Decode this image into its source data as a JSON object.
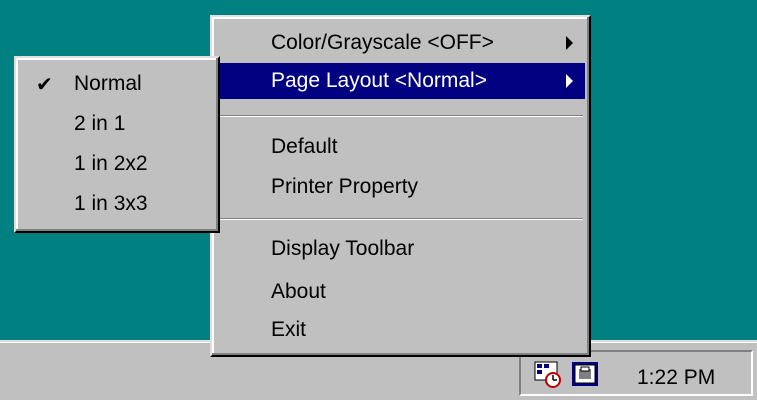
{
  "main_menu": {
    "items": [
      {
        "label": "Color/Grayscale <OFF>",
        "has_submenu": true,
        "highlighted": false
      },
      {
        "label": "Page Layout <Normal>",
        "has_submenu": true,
        "highlighted": true
      },
      {
        "label": "Default"
      },
      {
        "label": "Printer Property"
      },
      {
        "label": "Display Toolbar"
      },
      {
        "label": "About"
      },
      {
        "label": "Exit"
      }
    ]
  },
  "submenu": {
    "items": [
      {
        "label": "Normal",
        "checked": true
      },
      {
        "label": "2 in 1"
      },
      {
        "label": "1 in 2x2"
      },
      {
        "label": "1 in 3x3"
      }
    ],
    "check_glyph": "✔"
  },
  "taskbar": {
    "clock": "1:22 PM",
    "tray_icons": [
      "print-scheduler-icon",
      "printer-utility-icon"
    ]
  },
  "colors": {
    "desktop": "#008080",
    "menu_face": "#c0c0c0",
    "highlight": "#000080"
  }
}
